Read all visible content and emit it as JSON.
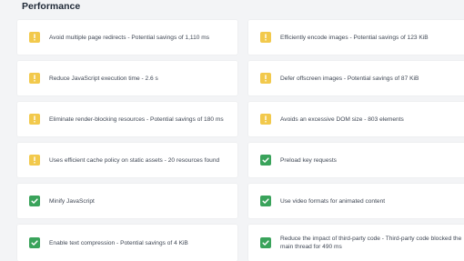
{
  "section": {
    "title": "Performance"
  },
  "colors": {
    "warning": "#f2c94c",
    "passed": "#3aa35b",
    "card_background": "#ffffff",
    "page_background": "#f3f4f6"
  },
  "audits": [
    {
      "label": "Avoid multiple page redirects - Potential savings of 1,110 ms",
      "status": "warning",
      "icon": "exclamation-icon"
    },
    {
      "label": "Efficiently encode images - Potential savings of 123 KiB",
      "status": "warning",
      "icon": "exclamation-icon"
    },
    {
      "label": "Reduce JavaScript execution time - 2.6 s",
      "status": "warning",
      "icon": "exclamation-icon"
    },
    {
      "label": "Defer offscreen images - Potential savings of 87 KiB",
      "status": "warning",
      "icon": "exclamation-icon"
    },
    {
      "label": "Eliminate render-blocking resources - Potential savings of 180 ms",
      "status": "warning",
      "icon": "exclamation-icon"
    },
    {
      "label": "Avoids an excessive DOM size - 803 elements",
      "status": "warning",
      "icon": "exclamation-icon"
    },
    {
      "label": "Uses efficient cache policy on static assets - 20 resources found",
      "status": "warning",
      "icon": "exclamation-icon"
    },
    {
      "label": "Preload key requests",
      "status": "passed",
      "icon": "check-icon"
    },
    {
      "label": "Minify JavaScript",
      "status": "passed",
      "icon": "check-icon"
    },
    {
      "label": "Use video formats for animated content",
      "status": "passed",
      "icon": "check-icon"
    },
    {
      "label": "Enable text compression - Potential savings of 4 KiB",
      "status": "passed",
      "icon": "check-icon"
    },
    {
      "label": "Reduce the impact of third-party code - Third-party code blocked the main thread for 490 ms",
      "status": "passed",
      "icon": "check-icon"
    }
  ]
}
